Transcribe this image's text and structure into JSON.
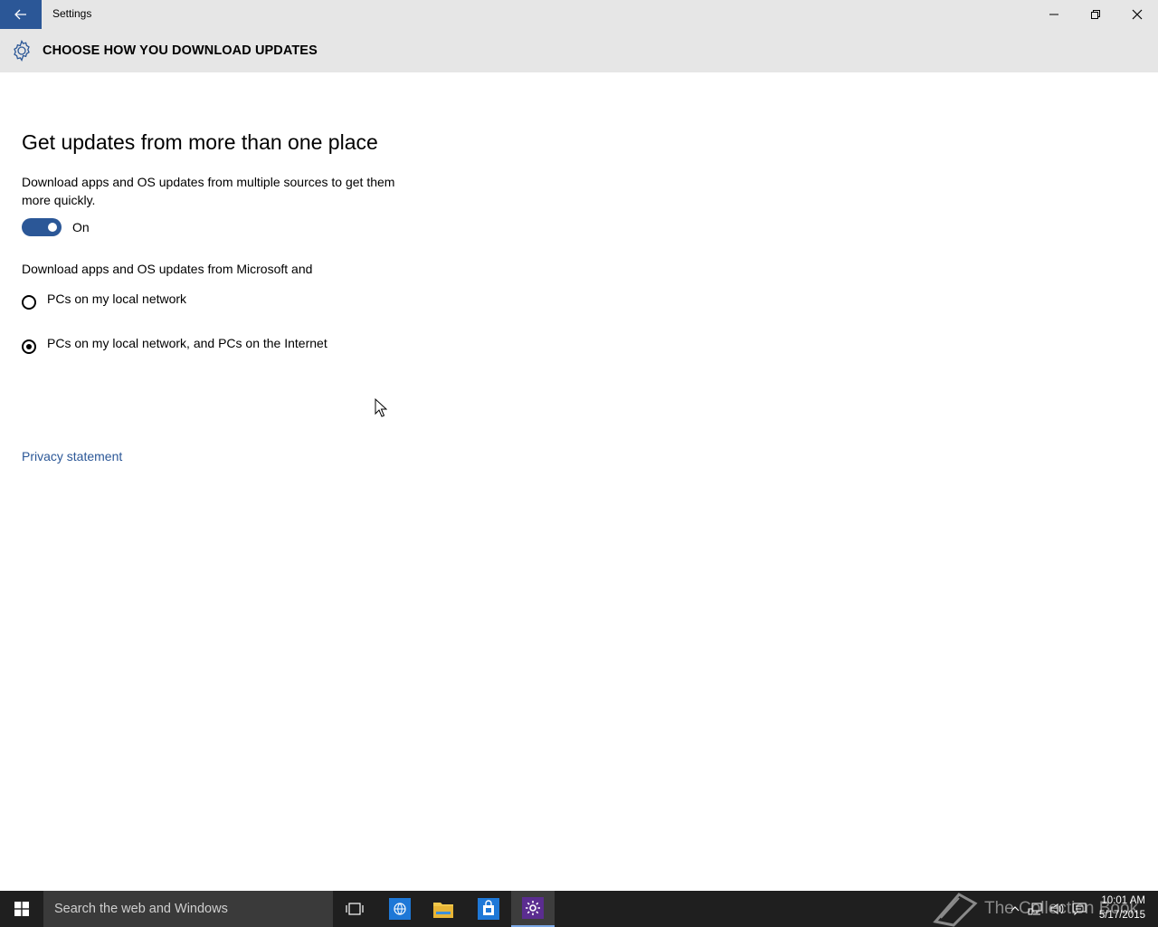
{
  "window": {
    "title": "Settings"
  },
  "header": {
    "title": "CHOOSE HOW YOU DOWNLOAD UPDATES"
  },
  "section": {
    "heading": "Get updates from more than one place",
    "description": "Download apps and OS updates from multiple sources to get them more quickly.",
    "toggle": {
      "state": "On",
      "on": true
    },
    "sub_label": "Download apps and OS updates from Microsoft and",
    "options": [
      {
        "label": "PCs on my local network",
        "selected": false
      },
      {
        "label": "PCs on my local network, and PCs on the Internet",
        "selected": true
      }
    ]
  },
  "links": {
    "privacy": "Privacy statement"
  },
  "taskbar": {
    "search_placeholder": "Search the web and Windows",
    "watermark": "The Collection Book",
    "time": "10:01 AM",
    "date": "5/17/2015"
  },
  "colors": {
    "accent": "#2b5797",
    "header_bg": "#e6e6e6",
    "taskbar_bg": "#1f1f1f"
  }
}
